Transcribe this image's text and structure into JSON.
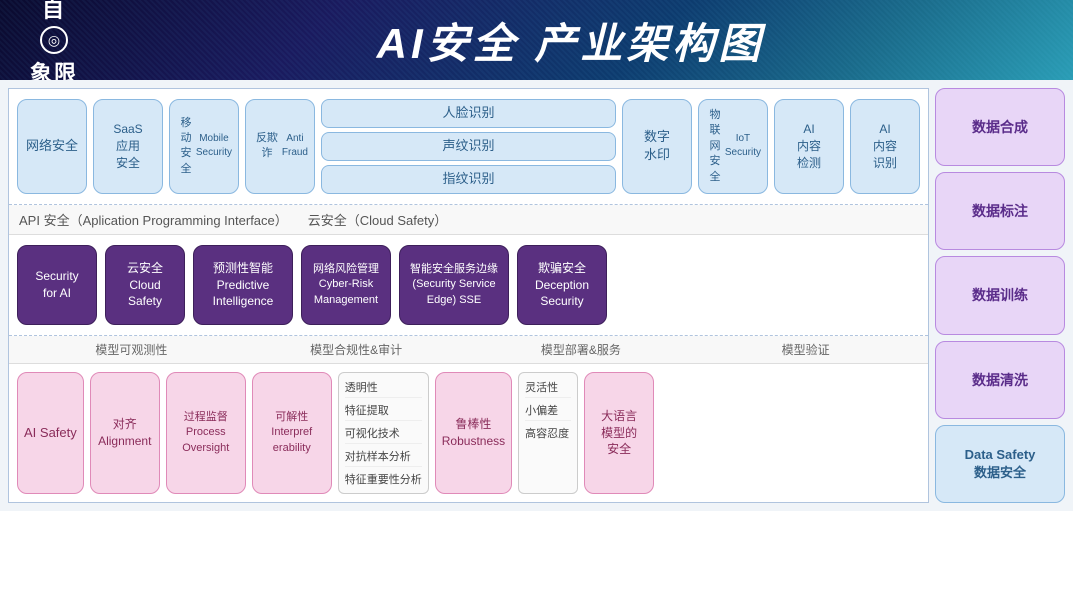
{
  "header": {
    "logo_top": "自",
    "logo_bottom": "象限",
    "title": "AI安全 产业架构图"
  },
  "top_section": {
    "cards": [
      {
        "id": "network-security",
        "label": "网络\n安全",
        "lines": [
          "网络",
          "安全"
        ]
      },
      {
        "id": "saas-security",
        "label": "SaaS\n应用\n安全",
        "lines": [
          "SaaS",
          "应用",
          "安全"
        ]
      },
      {
        "id": "mobile-security",
        "label": "移动\n安全\nMobile\nSecurity",
        "lines": [
          "移动",
          "安全",
          "Mobile",
          "Security"
        ]
      },
      {
        "id": "anti-fraud",
        "label": "反欺诈\nAnti\nFraud",
        "lines": [
          "反欺诈",
          "Anti",
          "Fraud"
        ]
      },
      {
        "id": "biometric-group",
        "sub": [
          "人脸识别",
          "声纹识别",
          "指纹识别"
        ]
      },
      {
        "id": "digital-watermark",
        "label": "数字\n水印",
        "lines": [
          "数字",
          "水印"
        ]
      },
      {
        "id": "iot-security",
        "label": "物联网\n安全\nIoT\nSecurity",
        "lines": [
          "物联网",
          "安全",
          "IoT",
          "Security"
        ]
      },
      {
        "id": "ai-content-detect",
        "label": "AI\n内容\n检测",
        "lines": [
          "AI",
          "内容",
          "检测"
        ]
      },
      {
        "id": "ai-content-recognize",
        "label": "AI\n内容\n识别",
        "lines": [
          "AI",
          "内容",
          "识别"
        ]
      }
    ]
  },
  "divider1": {
    "left": "API 安全（Aplication Programming Interface）",
    "right": "云安全（Cloud Safety）"
  },
  "mid_section": {
    "cards": [
      {
        "id": "security-for-ai",
        "label": "Security\nfor AI",
        "lines": [
          "Security",
          "for AI"
        ]
      },
      {
        "id": "cloud-safety",
        "label": "云安全\nCloud\nSafety",
        "lines": [
          "云安全",
          "Cloud",
          "Safety"
        ]
      },
      {
        "id": "predictive-intelligence",
        "label": "预测性智能\nPredictive\nIntelligence",
        "lines": [
          "预测性智能",
          "Predictive",
          "Intelligence"
        ]
      },
      {
        "id": "cyber-risk",
        "label": "网络风险管理\nCyber-Risk\nManagement",
        "lines": [
          "网络风险管理",
          "Cyber-Risk",
          "Management"
        ]
      },
      {
        "id": "sse",
        "label": "智能安全服务边缘\n(Security Service\nEdge) SSE",
        "lines": [
          "智能安全服务边缘",
          "(Security Service",
          "Edge) SSE"
        ]
      },
      {
        "id": "deception-security",
        "label": "欺骗安全\nDeception\nSecurity",
        "lines": [
          "欺骗安全",
          "Deception",
          "Security"
        ]
      }
    ]
  },
  "divider2": {
    "items": [
      "模型可观测性",
      "模型合规性&审计",
      "模型部署&服务",
      "模型验证"
    ]
  },
  "bottom_section": {
    "cards": [
      {
        "id": "ai-safety",
        "label": "AI Safety",
        "lines": [
          "AI Safety"
        ]
      },
      {
        "id": "alignment",
        "label": "对齐\nAlignment",
        "lines": [
          "对齐",
          "Alignment"
        ]
      },
      {
        "id": "process-oversight",
        "label": "过程监督\nProcess\nOversight",
        "lines": [
          "过程监督",
          "Process",
          "Oversight"
        ]
      },
      {
        "id": "interpretability",
        "label": "可解性\nInterpref\nerability",
        "lines": [
          "可解性",
          "Interpref",
          "erability"
        ]
      },
      {
        "id": "transparency-group",
        "items": [
          "透明性",
          "特征提取",
          "可视化技术",
          "对抗样本分析",
          "特征重要性分析"
        ]
      },
      {
        "id": "robustness",
        "label": "鲁棒性\nRobustness",
        "lines": [
          "鲁棒性",
          "Robustness"
        ]
      },
      {
        "id": "robustness-sub",
        "items": [
          "灵活性",
          "小偏差",
          "高容忍度"
        ]
      },
      {
        "id": "large-language",
        "label": "大语言\n模型的\n安全",
        "lines": [
          "大语言",
          "模型的",
          "安全"
        ]
      }
    ]
  },
  "right_panel": {
    "cards": [
      {
        "id": "data-synthesis",
        "label": "数据合成"
      },
      {
        "id": "data-labeling",
        "label": "数据标注"
      },
      {
        "id": "data-training",
        "label": "数据训练"
      },
      {
        "id": "data-cleaning",
        "label": "数据清洗"
      },
      {
        "id": "data-safety",
        "label": "Data Safety\n数据安全"
      }
    ]
  }
}
